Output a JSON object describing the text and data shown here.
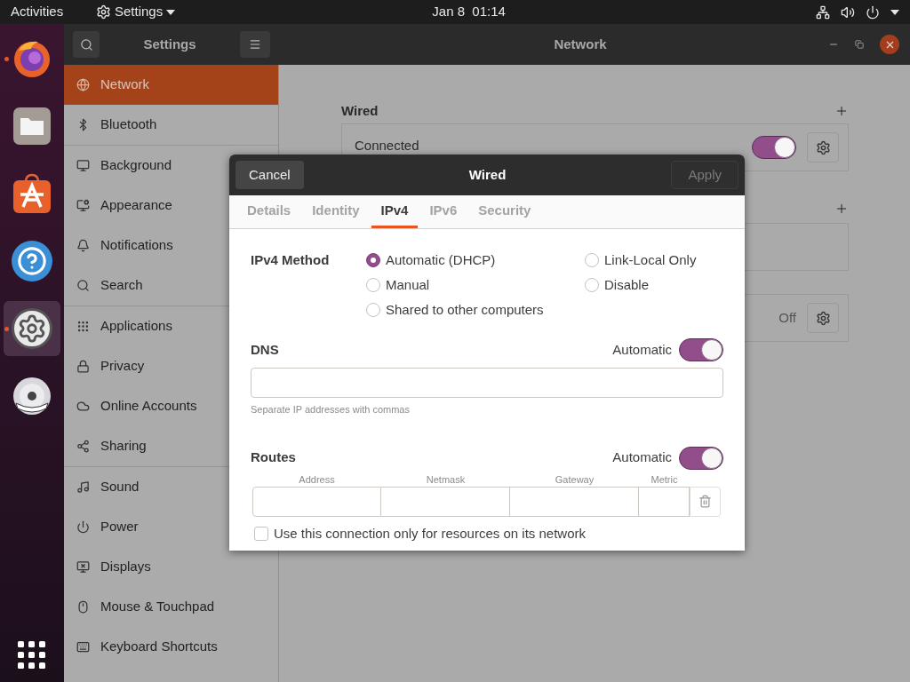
{
  "top_bar": {
    "activities": "Activities",
    "app_menu": "Settings",
    "clock": "Jan 8  01:14"
  },
  "dock": {
    "items": [
      {
        "kind": "firefox",
        "running": true,
        "selected": false
      },
      {
        "kind": "files",
        "running": false,
        "selected": false
      },
      {
        "kind": "software",
        "running": false,
        "selected": false
      },
      {
        "kind": "help",
        "running": false,
        "selected": false
      },
      {
        "kind": "settings",
        "running": true,
        "selected": true
      },
      {
        "kind": "dvd",
        "running": false,
        "selected": false
      }
    ]
  },
  "window": {
    "sidebar_title": "Settings",
    "title": "Network"
  },
  "sidebar": {
    "groups": [
      [
        {
          "label": "Network",
          "kind": "network",
          "selected": true
        },
        {
          "label": "Bluetooth",
          "kind": "bluetooth",
          "selected": false
        }
      ],
      [
        {
          "label": "Background",
          "kind": "background",
          "selected": false
        },
        {
          "label": "Appearance",
          "kind": "appearance",
          "selected": false
        },
        {
          "label": "Notifications",
          "kind": "bell",
          "selected": false
        },
        {
          "label": "Search",
          "kind": "search",
          "selected": false
        }
      ],
      [
        {
          "label": "Applications",
          "kind": "apps",
          "selected": false
        },
        {
          "label": "Privacy",
          "kind": "lock",
          "selected": false
        },
        {
          "label": "Online Accounts",
          "kind": "cloud",
          "selected": false
        },
        {
          "label": "Sharing",
          "kind": "share",
          "selected": false
        }
      ],
      [
        {
          "label": "Sound",
          "kind": "music",
          "selected": false
        },
        {
          "label": "Power",
          "kind": "power",
          "selected": false
        },
        {
          "label": "Displays",
          "kind": "display",
          "selected": false
        },
        {
          "label": "Mouse & Touchpad",
          "kind": "mouse",
          "selected": false
        },
        {
          "label": "Keyboard Shortcuts",
          "kind": "keyboard",
          "selected": false
        }
      ]
    ]
  },
  "main": {
    "wired": {
      "title": "Wired",
      "status": "Connected",
      "on": true
    },
    "proxy": {
      "status": "Off"
    }
  },
  "dialog": {
    "title": "Wired",
    "cancel": "Cancel",
    "apply": "Apply",
    "apply_disabled": true,
    "tabs": [
      {
        "label": "Details",
        "selected": false
      },
      {
        "label": "Identity",
        "selected": false
      },
      {
        "label": "IPv4",
        "selected": true
      },
      {
        "label": "IPv6",
        "selected": false
      },
      {
        "label": "Security",
        "selected": false
      }
    ],
    "method": {
      "label": "IPv4 Method",
      "columns": [
        [
          {
            "label": "Automatic (DHCP)",
            "selected": true
          },
          {
            "label": "Manual",
            "selected": false
          },
          {
            "label": "Shared to other computers",
            "selected": false
          }
        ],
        [
          {
            "label": "Link-Local Only",
            "selected": false
          },
          {
            "label": "Disable",
            "selected": false
          }
        ]
      ]
    },
    "dns": {
      "title": "DNS",
      "switch_label": "Automatic",
      "on": true,
      "hint": "Separate IP addresses with commas"
    },
    "routes": {
      "title": "Routes",
      "switch_label": "Automatic",
      "on": true,
      "columns": [
        "Address",
        "Netmask",
        "Gateway",
        "Metric"
      ]
    },
    "only_local": {
      "label": "Use this connection only for resources on its network",
      "checked": false
    }
  }
}
